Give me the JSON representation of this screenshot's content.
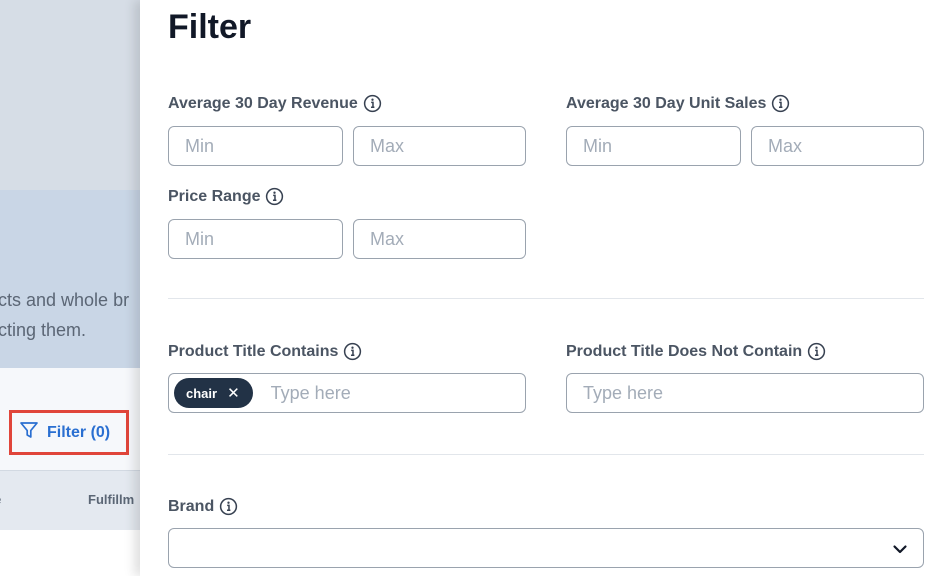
{
  "background": {
    "text_line1": "cts and whole br",
    "text_line2": "cting them.",
    "filter_button_label": "Filter (0)",
    "table_header_col": "Fulfillm",
    "table_header_col_left": "e"
  },
  "drawer": {
    "title": "Filter",
    "avg_revenue": {
      "label": "Average 30 Day Revenue",
      "min_placeholder": "Min",
      "max_placeholder": "Max"
    },
    "avg_unit_sales": {
      "label": "Average 30 Day Unit Sales",
      "min_placeholder": "Min",
      "max_placeholder": "Max"
    },
    "price_range": {
      "label": "Price Range",
      "min_placeholder": "Min",
      "max_placeholder": "Max"
    },
    "title_contains": {
      "label": "Product Title Contains",
      "chips": [
        "chair"
      ],
      "placeholder": "Type here"
    },
    "title_not_contains": {
      "label": "Product Title Does Not Contain",
      "placeholder": "Type here"
    },
    "brand": {
      "label": "Brand",
      "selected": ""
    }
  },
  "colors": {
    "accent_blue": "#2a6fd1",
    "highlight_red": "#e0453a",
    "chip_bg": "#223246"
  }
}
